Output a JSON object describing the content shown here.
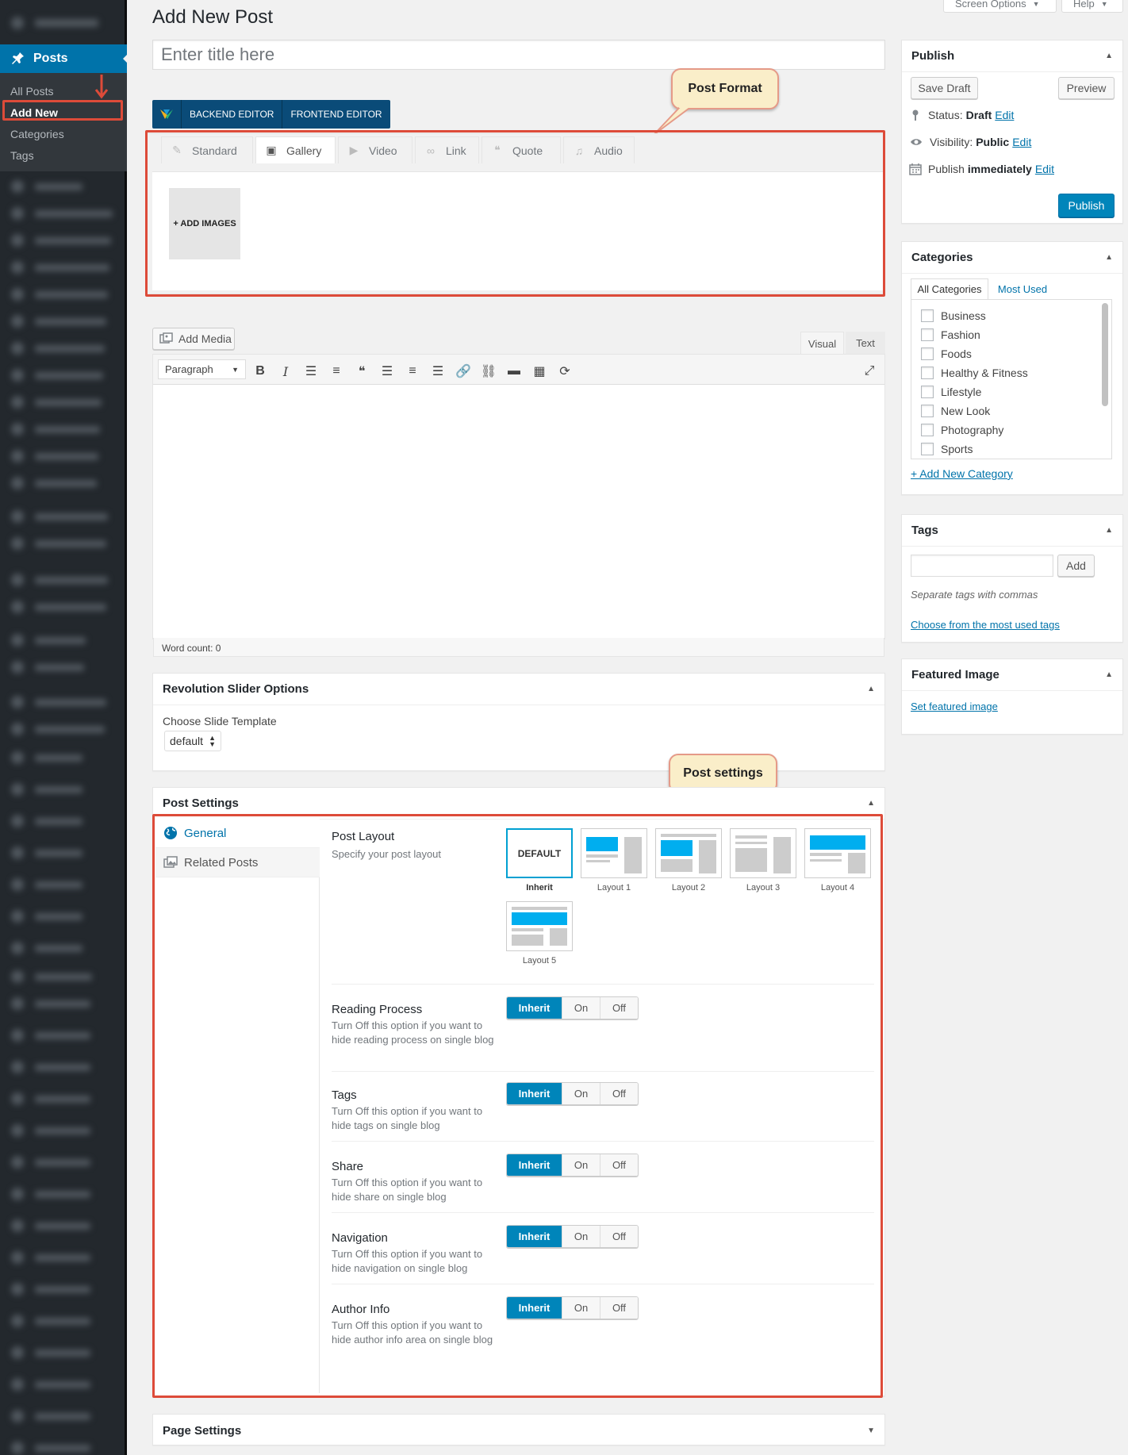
{
  "admin_menu": {
    "posts_label": "Posts",
    "submenu": [
      "All Posts",
      "Add New",
      "Categories",
      "Tags"
    ]
  },
  "screen_options_label": "Screen Options",
  "help_label": "Help",
  "page_title": "Add New Post",
  "title_placeholder": "Enter title here",
  "vc": {
    "backend": "BACKEND EDITOR",
    "frontend": "FRONTEND EDITOR"
  },
  "callouts": {
    "post_format": "Post Format",
    "post_settings": "Post settings"
  },
  "formats": [
    {
      "label": "Standard",
      "icon": "pin-icon"
    },
    {
      "label": "Gallery",
      "icon": "gallery-icon"
    },
    {
      "label": "Video",
      "icon": "video-icon"
    },
    {
      "label": "Link",
      "icon": "link-icon"
    },
    {
      "label": "Quote",
      "icon": "quote-icon"
    },
    {
      "label": "Audio",
      "icon": "audio-icon"
    }
  ],
  "add_images_label": "+ ADD IMAGES",
  "editor": {
    "add_media": "Add Media",
    "visual_tab": "Visual",
    "text_tab": "Text",
    "format_select": "Paragraph",
    "word_count": "Word count: 0"
  },
  "rev_slider": {
    "title": "Revolution Slider Options",
    "label": "Choose Slide Template",
    "value": "default"
  },
  "post_settings": {
    "title": "Post Settings",
    "tabs": [
      "General",
      "Related Posts"
    ],
    "layout_title": "Post Layout",
    "layout_desc": "Specify your post layout",
    "default_label": "DEFAULT",
    "layouts": [
      "Inherit",
      "Layout 1",
      "Layout 2",
      "Layout 3",
      "Layout 4",
      "Layout 5"
    ],
    "options": [
      {
        "title": "Reading Process",
        "desc": "Turn Off this option if you want to hide reading process on single blog"
      },
      {
        "title": "Tags",
        "desc": "Turn Off this option if you want to hide tags on single blog"
      },
      {
        "title": "Share",
        "desc": "Turn Off this option if you want to hide share on single blog"
      },
      {
        "title": "Navigation",
        "desc": "Turn Off this option if you want to hide navigation on single blog"
      },
      {
        "title": "Author Info",
        "desc": "Turn Off this option if you want to hide author info area on single blog"
      }
    ],
    "toggle_labels": [
      "Inherit",
      "On",
      "Off"
    ],
    "selected": "Inherit"
  },
  "page_settings_title": "Page Settings",
  "publish": {
    "title": "Publish",
    "save_draft": "Save Draft",
    "preview": "Preview",
    "status_label": "Status:",
    "status_value": "Draft",
    "visibility_label": "Visibility:",
    "visibility_value": "Public",
    "publish_label": "Publish",
    "publish_value": "immediately",
    "edit": "Edit",
    "publish_button": "Publish"
  },
  "categories": {
    "title": "Categories",
    "tab_all": "All Categories",
    "tab_used": "Most Used",
    "items": [
      "Business",
      "Fashion",
      "Foods",
      "Healthy & Fitness",
      "Lifestyle",
      "New Look",
      "Photography",
      "Sports"
    ],
    "add_new": "+ Add New Category"
  },
  "tags_box": {
    "title": "Tags",
    "add": "Add",
    "hint": "Separate tags with commas",
    "choose": "Choose from the most used tags"
  },
  "featured": {
    "title": "Featured Image",
    "link": "Set featured image"
  },
  "colors": {
    "accent": "#0085ba",
    "highlight": "#dd4b39",
    "menu_bg": "#23282d"
  }
}
